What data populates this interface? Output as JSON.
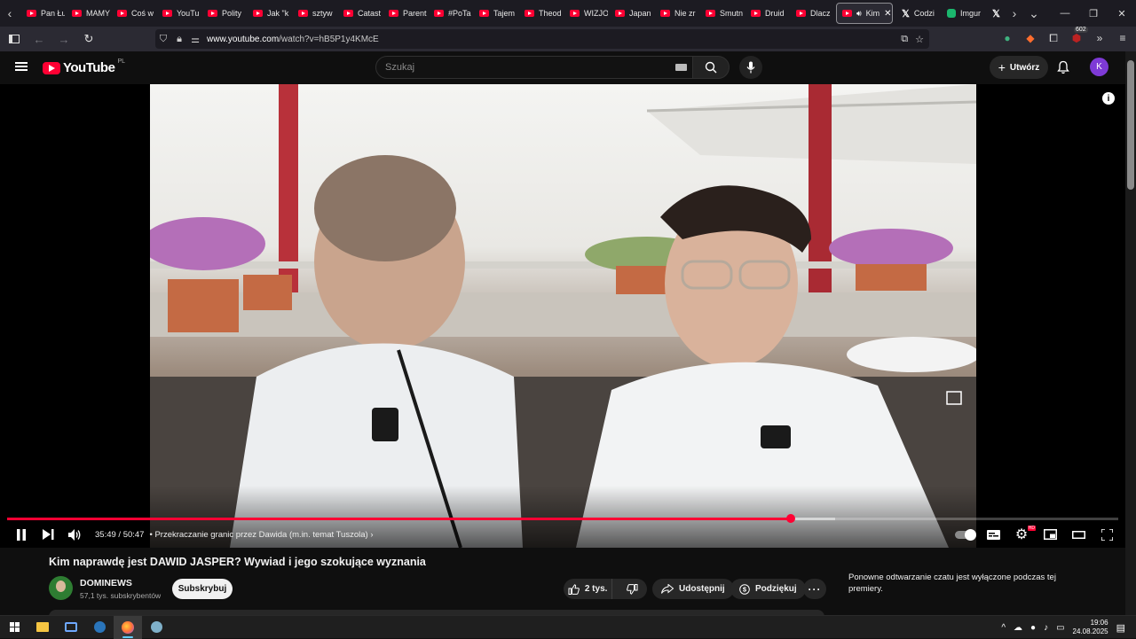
{
  "browser": {
    "tabs": [
      {
        "label": "Pan Łu",
        "kind": "yt"
      },
      {
        "label": "MAMY",
        "kind": "yt"
      },
      {
        "label": "Coś w",
        "kind": "yt"
      },
      {
        "label": "YouTu",
        "kind": "yt"
      },
      {
        "label": "Polity",
        "kind": "yt"
      },
      {
        "label": "Jak \"k",
        "kind": "yt"
      },
      {
        "label": "sztyw",
        "kind": "yt"
      },
      {
        "label": "Catast",
        "kind": "yt"
      },
      {
        "label": "Parent",
        "kind": "yt"
      },
      {
        "label": "#PoTa",
        "kind": "yt"
      },
      {
        "label": "Tajem",
        "kind": "yt"
      },
      {
        "label": "Theod",
        "kind": "yt"
      },
      {
        "label": "WIZJO",
        "kind": "yt"
      },
      {
        "label": "Japan",
        "kind": "yt"
      },
      {
        "label": "Nie zr",
        "kind": "yt"
      },
      {
        "label": "Smutn",
        "kind": "yt"
      },
      {
        "label": "Druid",
        "kind": "yt"
      },
      {
        "label": "Dlacz",
        "kind": "yt"
      }
    ],
    "active_tab": {
      "label": "Kim"
    },
    "after_tabs": [
      {
        "label": "Codzi",
        "kind": "x"
      },
      {
        "label": "Imgur",
        "kind": "imgur"
      },
      {
        "label": "",
        "kind": "x"
      }
    ],
    "url_host": "www.youtube.com",
    "url_path": "/watch?v=hB5P1y4KMcE",
    "extensions_badge": "602"
  },
  "youtube": {
    "logo_word": "YouTube",
    "region": "PL",
    "search_placeholder": "Szukaj",
    "create_label": "Utwórz",
    "avatar_letter": "K"
  },
  "player": {
    "current_time": "35:49",
    "duration": "50:47",
    "time_display": "35:49 / 50:47",
    "chapter": "Przekraczanie granic przez Dawida (m.in. temat Tuszola)",
    "played_fraction": 0.705,
    "buffered_fraction": 0.745,
    "paused": false
  },
  "video": {
    "title": "Kim naprawdę jest DAWID JASPER? Wywiad i jego szokujące wyznania",
    "channel": "DOMINEWS",
    "subscribers": "57,1 tys. subskrybentów",
    "subscribe_label": "Subskrybuj",
    "likes": "2 tys.",
    "share_label": "Udostępnij",
    "thanks_label": "Podziękuj"
  },
  "chat_note": "Ponowne odtwarzanie czatu jest wyłączone podczas tej premiery.",
  "taskbar": {
    "time": "19:06",
    "date": "24.08.2025"
  },
  "colors": {
    "accent": "#ff0033",
    "background": "#0f0f0f",
    "avatar": "#7e3ad6"
  }
}
